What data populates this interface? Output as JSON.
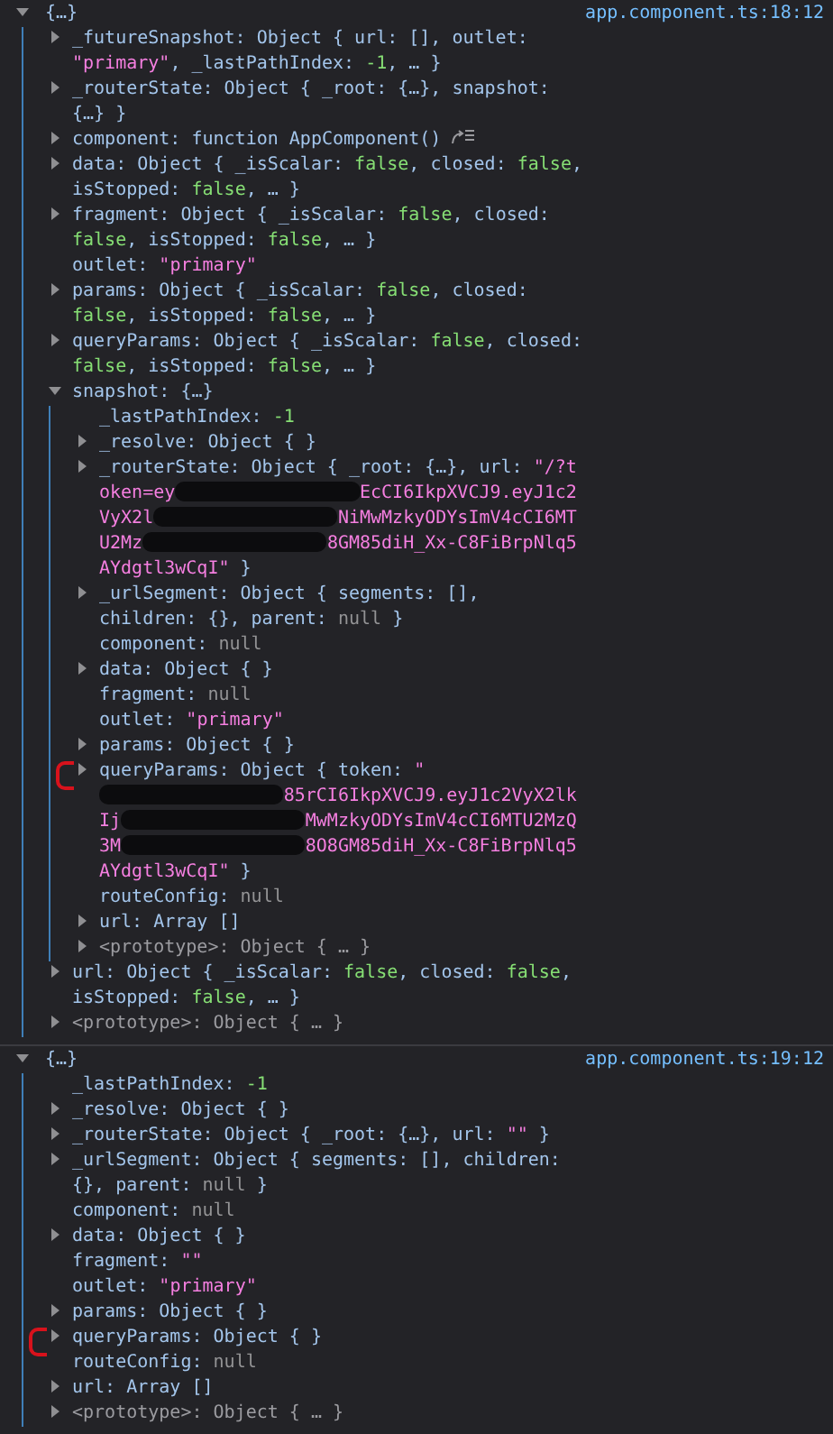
{
  "messages": [
    {
      "summary": "{…}",
      "expanded": true,
      "source": "app.component.ts:18:12",
      "entries": [
        {
          "expanded": false,
          "parts": [
            {
              "kind": "plain",
              "text": "_futureSnapshot: Object { url: [], outlet: "
            },
            {
              "kind": "string",
              "text": "\"primary\""
            },
            {
              "kind": "plain",
              "text": ", _lastPathIndex: "
            },
            {
              "kind": "number",
              "text": "-1"
            },
            {
              "kind": "plain",
              "text": ", … }"
            }
          ]
        },
        {
          "expanded": false,
          "parts": [
            {
              "kind": "plain",
              "text": "_routerState: Object { _root: {…}, snapshot: {…} }"
            }
          ]
        },
        {
          "expanded": false,
          "parts": [
            {
              "kind": "plain",
              "text": "component: function AppComponent()"
            },
            {
              "kind": "jump"
            }
          ]
        },
        {
          "expanded": false,
          "parts": [
            {
              "kind": "plain",
              "text": "data: Object { _isScalar: "
            },
            {
              "kind": "number",
              "text": "false"
            },
            {
              "kind": "plain",
              "text": ", closed: "
            },
            {
              "kind": "number",
              "text": "false"
            },
            {
              "kind": "plain",
              "text": ", isStopped: "
            },
            {
              "kind": "number",
              "text": "false"
            },
            {
              "kind": "plain",
              "text": ", … }"
            }
          ]
        },
        {
          "expanded": false,
          "parts": [
            {
              "kind": "plain",
              "text": "fragment: Object { _isScalar: "
            },
            {
              "kind": "number",
              "text": "false"
            },
            {
              "kind": "plain",
              "text": ", closed: "
            },
            {
              "kind": "number",
              "text": "false"
            },
            {
              "kind": "plain",
              "text": ", isStopped: "
            },
            {
              "kind": "number",
              "text": "false"
            },
            {
              "kind": "plain",
              "text": ", … }"
            }
          ]
        },
        {
          "parts": [
            {
              "kind": "plain",
              "text": "outlet: "
            },
            {
              "kind": "string",
              "text": "\"primary\""
            }
          ]
        },
        {
          "expanded": false,
          "parts": [
            {
              "kind": "plain",
              "text": "params: Object { _isScalar: "
            },
            {
              "kind": "number",
              "text": "false"
            },
            {
              "kind": "plain",
              "text": ", closed: "
            },
            {
              "kind": "number",
              "text": "false"
            },
            {
              "kind": "plain",
              "text": ", isStopped: "
            },
            {
              "kind": "number",
              "text": "false"
            },
            {
              "kind": "plain",
              "text": ", … }"
            }
          ]
        },
        {
          "expanded": false,
          "parts": [
            {
              "kind": "plain",
              "text": "queryParams: Object { _isScalar: "
            },
            {
              "kind": "number",
              "text": "false"
            },
            {
              "kind": "plain",
              "text": ", closed: "
            },
            {
              "kind": "number",
              "text": "false"
            },
            {
              "kind": "plain",
              "text": ", isStopped: "
            },
            {
              "kind": "number",
              "text": "false"
            },
            {
              "kind": "plain",
              "text": ", … }"
            }
          ]
        },
        {
          "expanded": true,
          "parts": [
            {
              "kind": "plain",
              "text": "snapshot: {…}"
            }
          ],
          "children": [
            {
              "parts": [
                {
                  "kind": "plain",
                  "text": "_lastPathIndex: "
                },
                {
                  "kind": "number",
                  "text": "-1"
                }
              ]
            },
            {
              "expanded": false,
              "parts": [
                {
                  "kind": "plain",
                  "text": "_resolve: Object {  }"
                }
              ]
            },
            {
              "expanded": false,
              "parts": [
                {
                  "kind": "plain",
                  "text": "_routerState: Object { _root: {…}, url: "
                },
                {
                  "kind": "string",
                  "text": "\"/?token=ey"
                },
                {
                  "kind": "redacted"
                },
                {
                  "kind": "string",
                  "text": "EcCI6IkpXVCJ9.eyJ1c2VyX2l"
                },
                {
                  "kind": "redacted"
                },
                {
                  "kind": "string",
                  "text": "NiMwMzkyODYsImV4cCI6MTU2Mz"
                },
                {
                  "kind": "redacted"
                },
                {
                  "kind": "string",
                  "text": "8GM85diH_Xx-C8FiBrpNlq5AYdgtl3wCqI\""
                },
                {
                  "kind": "plain",
                  "text": " }"
                }
              ]
            },
            {
              "expanded": false,
              "parts": [
                {
                  "kind": "plain",
                  "text": "_urlSegment: Object { segments: [], children: {}, parent: "
                },
                {
                  "kind": "null",
                  "text": "null"
                },
                {
                  "kind": "plain",
                  "text": " }"
                }
              ]
            },
            {
              "parts": [
                {
                  "kind": "plain",
                  "text": "component: "
                },
                {
                  "kind": "null",
                  "text": "null"
                }
              ]
            },
            {
              "expanded": false,
              "parts": [
                {
                  "kind": "plain",
                  "text": "data: Object {  }"
                }
              ]
            },
            {
              "parts": [
                {
                  "kind": "plain",
                  "text": "fragment: "
                },
                {
                  "kind": "null",
                  "text": "null"
                }
              ]
            },
            {
              "parts": [
                {
                  "kind": "plain",
                  "text": "outlet: "
                },
                {
                  "kind": "string",
                  "text": "\"primary\""
                }
              ]
            },
            {
              "expanded": false,
              "parts": [
                {
                  "kind": "plain",
                  "text": "params: Object {  }"
                }
              ]
            },
            {
              "expanded": false,
              "annotated": true,
              "parts": [
                {
                  "kind": "plain",
                  "text": "queryParams: Object { token: "
                },
                {
                  "kind": "string",
                  "text": "\""
                },
                {
                  "kind": "redacted"
                },
                {
                  "kind": "string",
                  "text": "85rCI6IkpXVCJ9.eyJ1c2VyX2lkIj"
                },
                {
                  "kind": "redacted"
                },
                {
                  "kind": "string",
                  "text": "MwMzkyODYsImV4cCI6MTU2MzQ3M"
                },
                {
                  "kind": "redacted"
                },
                {
                  "kind": "string",
                  "text": "8O8GM85diH_Xx-C8FiBrpNlq5AYdgtl3wCqI\""
                },
                {
                  "kind": "plain",
                  "text": " }"
                }
              ]
            },
            {
              "parts": [
                {
                  "kind": "plain",
                  "text": "routeConfig: "
                },
                {
                  "kind": "null",
                  "text": "null"
                }
              ]
            },
            {
              "expanded": false,
              "parts": [
                {
                  "kind": "plain",
                  "text": "url: Array []"
                }
              ]
            },
            {
              "expanded": false,
              "parts": [
                {
                  "kind": "muted",
                  "text": "<prototype>: Object { … }"
                }
              ]
            }
          ]
        },
        {
          "expanded": false,
          "parts": [
            {
              "kind": "plain",
              "text": "url: Object { _isScalar: "
            },
            {
              "kind": "number",
              "text": "false"
            },
            {
              "kind": "plain",
              "text": ", closed: "
            },
            {
              "kind": "number",
              "text": "false"
            },
            {
              "kind": "plain",
              "text": ", isStopped: "
            },
            {
              "kind": "number",
              "text": "false"
            },
            {
              "kind": "plain",
              "text": ", … }"
            }
          ]
        },
        {
          "expanded": false,
          "parts": [
            {
              "kind": "muted",
              "text": "<prototype>: Object { … }"
            }
          ]
        }
      ]
    },
    {
      "summary": "{…}",
      "expanded": true,
      "source": "app.component.ts:19:12",
      "entries": [
        {
          "parts": [
            {
              "kind": "plain",
              "text": "_lastPathIndex: "
            },
            {
              "kind": "number",
              "text": "-1"
            }
          ]
        },
        {
          "expanded": false,
          "parts": [
            {
              "kind": "plain",
              "text": "_resolve: Object {  }"
            }
          ]
        },
        {
          "expanded": false,
          "parts": [
            {
              "kind": "plain",
              "text": "_routerState: Object { _root: {…}, url: "
            },
            {
              "kind": "string",
              "text": "\"\""
            },
            {
              "kind": "plain",
              "text": " }"
            }
          ]
        },
        {
          "expanded": false,
          "parts": [
            {
              "kind": "plain",
              "text": "_urlSegment: Object { segments: [], children: {}, parent: "
            },
            {
              "kind": "null",
              "text": "null"
            },
            {
              "kind": "plain",
              "text": " }"
            }
          ]
        },
        {
          "parts": [
            {
              "kind": "plain",
              "text": "component: "
            },
            {
              "kind": "null",
              "text": "null"
            }
          ]
        },
        {
          "expanded": false,
          "parts": [
            {
              "kind": "plain",
              "text": "data: Object {  }"
            }
          ]
        },
        {
          "parts": [
            {
              "kind": "plain",
              "text": "fragment: "
            },
            {
              "kind": "string",
              "text": "\"\""
            }
          ]
        },
        {
          "parts": [
            {
              "kind": "plain",
              "text": "outlet: "
            },
            {
              "kind": "string",
              "text": "\"primary\""
            }
          ]
        },
        {
          "expanded": false,
          "parts": [
            {
              "kind": "plain",
              "text": "params: Object {  }"
            }
          ]
        },
        {
          "expanded": false,
          "annotated": true,
          "parts": [
            {
              "kind": "plain",
              "text": "queryParams: Object {  }"
            }
          ]
        },
        {
          "parts": [
            {
              "kind": "plain",
              "text": "routeConfig: "
            },
            {
              "kind": "null",
              "text": "null"
            }
          ]
        },
        {
          "expanded": false,
          "parts": [
            {
              "kind": "plain",
              "text": "url: Array []"
            }
          ]
        },
        {
          "expanded": false,
          "parts": [
            {
              "kind": "muted",
              "text": "<prototype>: Object { … }"
            }
          ]
        }
      ]
    }
  ]
}
